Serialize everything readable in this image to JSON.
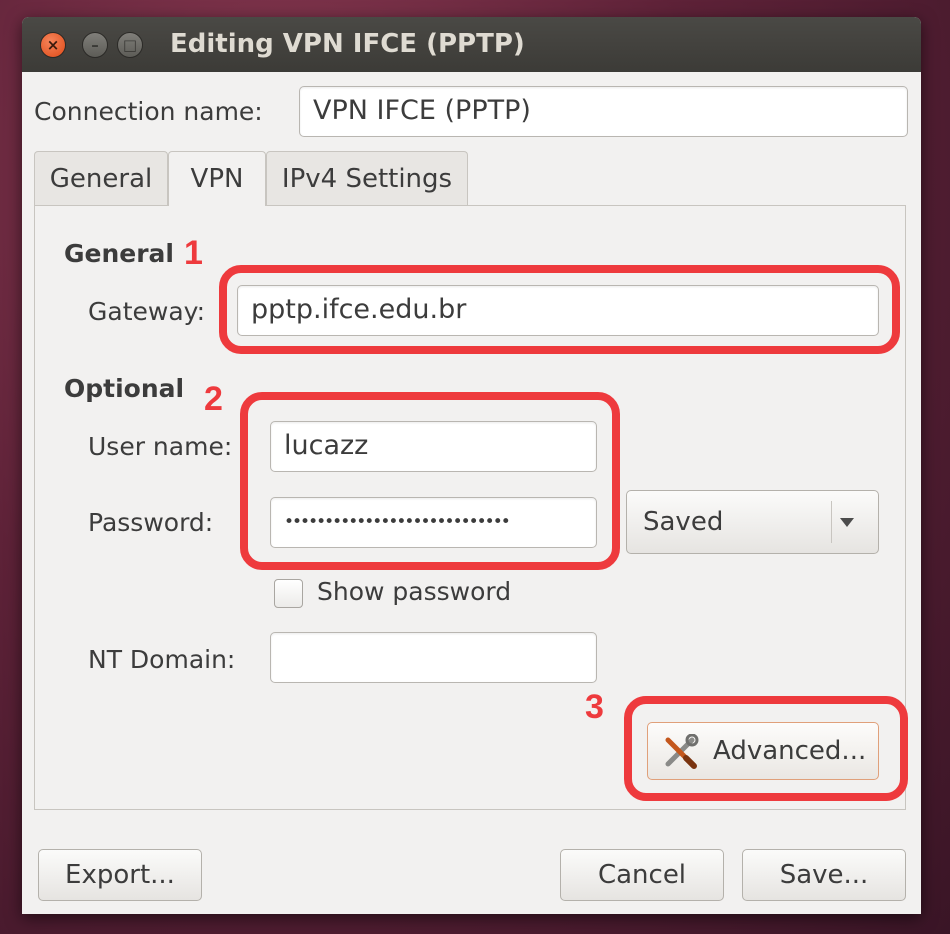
{
  "window": {
    "title": "Editing VPN IFCE (PPTP)"
  },
  "connection": {
    "label": "Connection name:",
    "value": "VPN IFCE (PPTP)"
  },
  "tabs": [
    {
      "label": "General"
    },
    {
      "label": "VPN"
    },
    {
      "label": "IPv4 Settings"
    }
  ],
  "vpn": {
    "general_heading": "General",
    "gateway_label": "Gateway:",
    "gateway_value": "pptp.ifce.edu.br",
    "optional_heading": "Optional",
    "username_label": "User name:",
    "username_value": "lucazz",
    "password_label": "Password:",
    "password_mask": "••••••••••••••••••••••••••••",
    "password_storage": "Saved",
    "show_password_label": "Show password",
    "ntdomain_label": "NT Domain:",
    "ntdomain_value": "",
    "advanced_label": "Advanced..."
  },
  "annotations": [
    "1",
    "2",
    "3"
  ],
  "footer": {
    "export": "Export...",
    "cancel": "Cancel",
    "save": "Save..."
  },
  "colors": {
    "marker": "#ee3a3d",
    "titlebar": "#3c3b37",
    "close_button": "#df4a17"
  },
  "icons": [
    "close-icon",
    "minimize-icon",
    "maximize-icon",
    "dropdown-arrow-icon",
    "tools-icon"
  ]
}
